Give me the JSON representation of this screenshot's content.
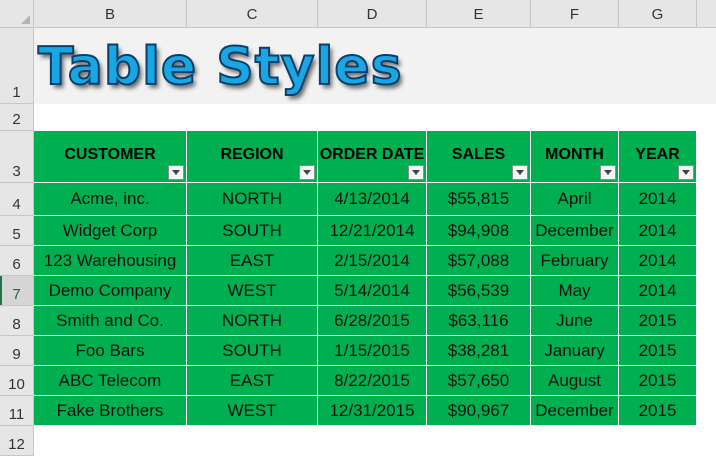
{
  "spreadsheet": {
    "columns": [
      "B",
      "C",
      "D",
      "E",
      "F",
      "G"
    ],
    "rows": [
      "1",
      "2",
      "3",
      "4",
      "5",
      "6",
      "7",
      "8",
      "9",
      "10",
      "11",
      "12"
    ],
    "active_row": "7"
  },
  "title": "Table Styles",
  "table": {
    "headers": [
      "CUSTOMER",
      "REGION",
      "ORDER DATE",
      "SALES",
      "MONTH",
      "YEAR"
    ],
    "rows": [
      [
        "Acme, inc.",
        "NORTH",
        "4/13/2014",
        "$55,815",
        "April",
        "2014"
      ],
      [
        "Widget Corp",
        "SOUTH",
        "12/21/2014",
        "$94,908",
        "December",
        "2014"
      ],
      [
        "123 Warehousing",
        "EAST",
        "2/15/2014",
        "$57,088",
        "February",
        "2014"
      ],
      [
        "Demo Company",
        "WEST",
        "5/14/2014",
        "$56,539",
        "May",
        "2014"
      ],
      [
        "Smith and Co.",
        "NORTH",
        "6/28/2015",
        "$63,116",
        "June",
        "2015"
      ],
      [
        "Foo Bars",
        "SOUTH",
        "1/15/2015",
        "$38,281",
        "January",
        "2015"
      ],
      [
        "ABC Telecom",
        "EAST",
        "8/22/2015",
        "$57,650",
        "August",
        "2015"
      ],
      [
        "Fake Brothers",
        "WEST",
        "12/31/2015",
        "$90,967",
        "December",
        "2015"
      ]
    ]
  },
  "colors": {
    "table_fill": "#00b050",
    "title_fill": "#1aa6e3",
    "title_outline": "#0b3f6b",
    "header_bg": "#e6e6e6",
    "active_row_accent": "#217346"
  },
  "icons": {
    "filter": "filter-dropdown-icon",
    "select_all": "select-all-triangle-icon"
  }
}
